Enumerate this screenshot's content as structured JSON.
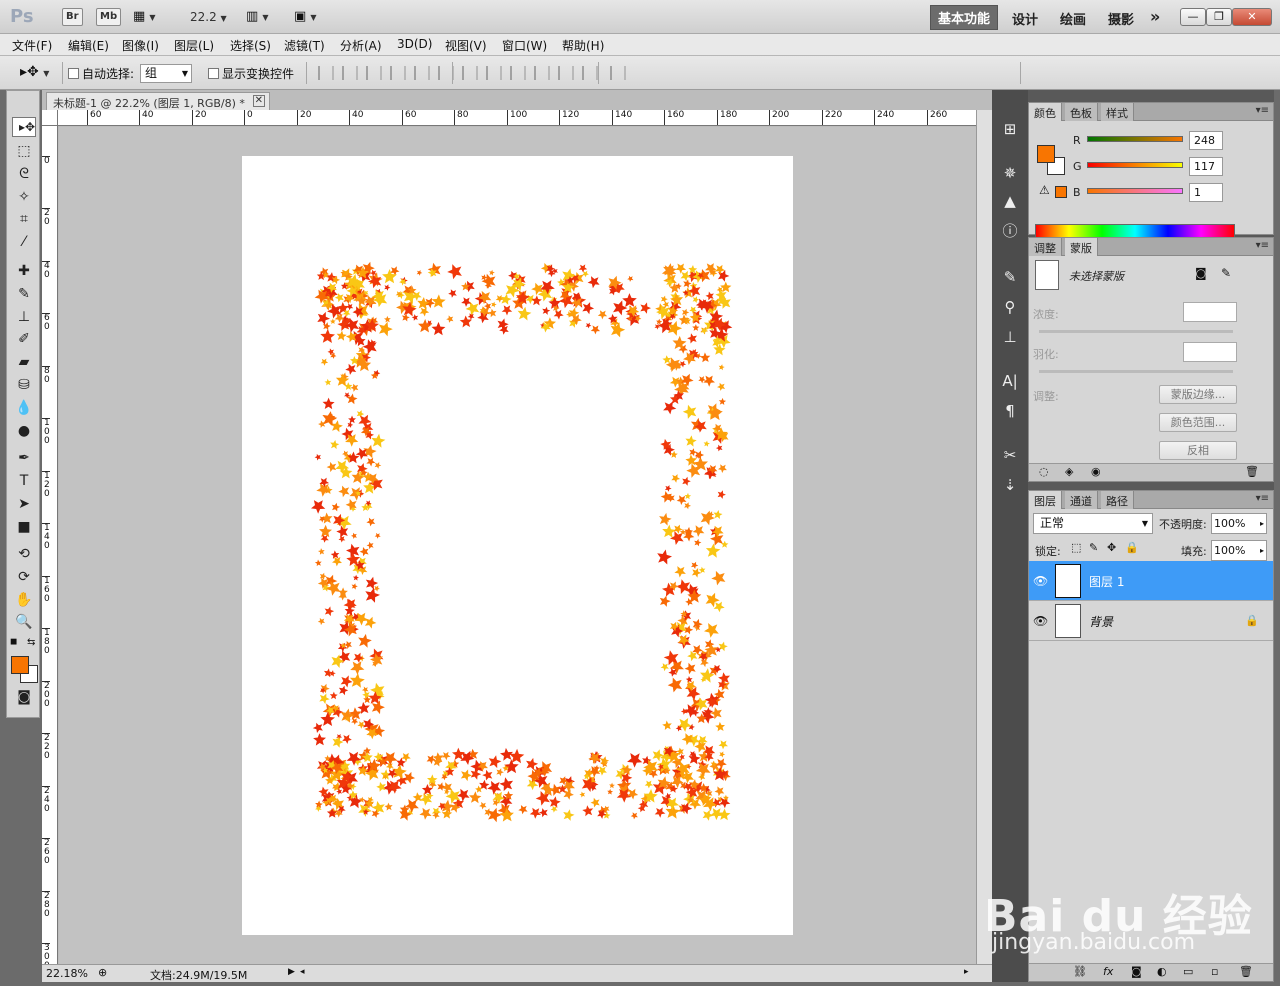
{
  "app": {
    "logo": "Ps",
    "br": "Br",
    "mb": "Mb",
    "zoom": "22.2",
    "workspaces": [
      "基本功能",
      "设计",
      "绘画",
      "摄影"
    ],
    "active_workspace": "基本功能",
    "more": "»"
  },
  "menu": [
    "文件(F)",
    "编辑(E)",
    "图像(I)",
    "图层(L)",
    "选择(S)",
    "滤镜(T)",
    "分析(A)",
    "3D(D)",
    "视图(V)",
    "窗口(W)",
    "帮助(H)"
  ],
  "options": {
    "auto_select": "自动选择:",
    "group": "组",
    "show_transform": "显示变换控件"
  },
  "document": {
    "tab": "未标题-1 @ 22.2% (图层 1, RGB/8) *",
    "hruler": [
      "60",
      "40",
      "20",
      "0",
      "20",
      "40",
      "60",
      "80",
      "100",
      "120",
      "140",
      "160",
      "180",
      "200",
      "220",
      "240",
      "260"
    ],
    "vruler": [
      "0",
      "20",
      "40",
      "60",
      "80",
      "100",
      "120",
      "140",
      "160",
      "180",
      "200",
      "220",
      "240",
      "260",
      "280",
      "300"
    ],
    "status_zoom": "22.18%",
    "status_doc": "文档:24.9M/19.5M"
  },
  "color_panel": {
    "tabs": [
      "颜色",
      "色板",
      "样式"
    ],
    "r_label": "R",
    "g_label": "G",
    "b_label": "B",
    "r": "248",
    "g": "117",
    "b": "1",
    "fg": "#f87501"
  },
  "masks_panel": {
    "tabs": [
      "调整",
      "蒙版"
    ],
    "title": "未选择蒙版",
    "density": "浓度:",
    "feather": "羽化:",
    "refine": "调整:",
    "btn_edge": "蒙版边缘...",
    "btn_range": "颜色范围...",
    "btn_invert": "反相"
  },
  "layers_panel": {
    "tabs": [
      "图层",
      "通道",
      "路径"
    ],
    "blend": "正常",
    "opacity_label": "不透明度:",
    "opacity": "100%",
    "lock_label": "锁定:",
    "fill_label": "填充:",
    "fill": "100%",
    "layers": [
      {
        "name": "图层 1",
        "active": true
      },
      {
        "name": "背景",
        "active": false
      }
    ],
    "bottom_fx": "fx"
  },
  "watermark": {
    "main": "Bai du 经验",
    "sub": "jingyan.baidu.com"
  }
}
